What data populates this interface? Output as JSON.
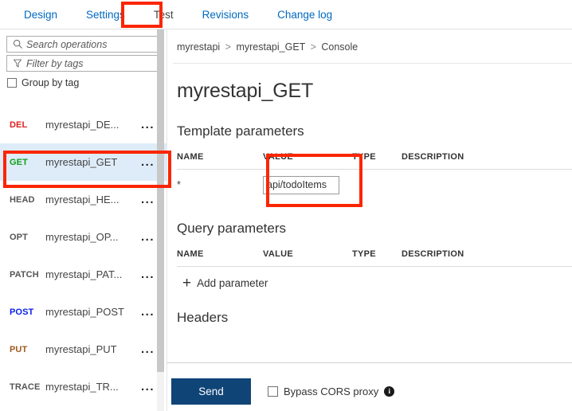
{
  "tabs": [
    {
      "label": "Design",
      "active": false
    },
    {
      "label": "Settings",
      "active": false
    },
    {
      "label": "Test",
      "active": true
    },
    {
      "label": "Revisions",
      "active": false
    },
    {
      "label": "Change log",
      "active": false
    }
  ],
  "sidebar": {
    "search": {
      "placeholder": "Search operations",
      "value": "",
      "icon": "search-icon"
    },
    "filter": {
      "placeholder": "Filter by tags",
      "value": "",
      "icon": "filter-icon"
    },
    "group_by_tag": {
      "label": "Group by tag",
      "checked": false
    },
    "operations": [
      {
        "method": "DEL",
        "name": "myrestapi_DE...",
        "color": "#e02020",
        "selected": false,
        "menu": "..."
      },
      {
        "method": "GET",
        "name": "myrestapi_GET",
        "color": "#0f9d18",
        "selected": true,
        "menu": "..."
      },
      {
        "method": "HEAD",
        "name": "myrestapi_HE...",
        "color": "#555555",
        "selected": false,
        "menu": "..."
      },
      {
        "method": "OPT",
        "name": "myrestapi_OP...",
        "color": "#555555",
        "selected": false,
        "menu": "..."
      },
      {
        "method": "PATCH",
        "name": "myrestapi_PAT...",
        "color": "#555555",
        "selected": false,
        "menu": "..."
      },
      {
        "method": "POST",
        "name": "myrestapi_POST",
        "color": "#0b21e8",
        "selected": false,
        "menu": "..."
      },
      {
        "method": "PUT",
        "name": "myrestapi_PUT",
        "color": "#a05a20",
        "selected": false,
        "menu": "..."
      },
      {
        "method": "TRACE",
        "name": "myrestapi_TR...",
        "color": "#555555",
        "selected": false,
        "menu": "..."
      }
    ]
  },
  "main": {
    "breadcrumb": {
      "root": "myrestapi",
      "middle": "myrestapi_GET",
      "leaf": "Console",
      "separator": ">"
    },
    "title": "myrestapi_GET",
    "template_parameters": {
      "heading": "Template parameters",
      "columns": [
        "NAME",
        "VALUE",
        "TYPE",
        "DESCRIPTION"
      ],
      "rows": [
        {
          "name": "*",
          "value": "api/todoItems",
          "type": "",
          "description": ""
        }
      ]
    },
    "query_parameters": {
      "heading": "Query parameters",
      "columns": [
        "NAME",
        "VALUE",
        "TYPE",
        "DESCRIPTION"
      ],
      "rows": [],
      "add_label": "Add parameter"
    },
    "headers": {
      "heading": "Headers"
    },
    "actions": {
      "send_label": "Send",
      "bypass_cors": {
        "label": "Bypass CORS proxy",
        "checked": false,
        "info_icon": "info-icon"
      }
    }
  },
  "annotations": {
    "accent_color": "#fa2600",
    "boxes": [
      {
        "id": "annot-test",
        "target": "tab-test"
      },
      {
        "id": "annot-get",
        "target": "sidebar-operation-get"
      },
      {
        "id": "annot-value",
        "target": "template-parameters-value-column"
      }
    ]
  }
}
